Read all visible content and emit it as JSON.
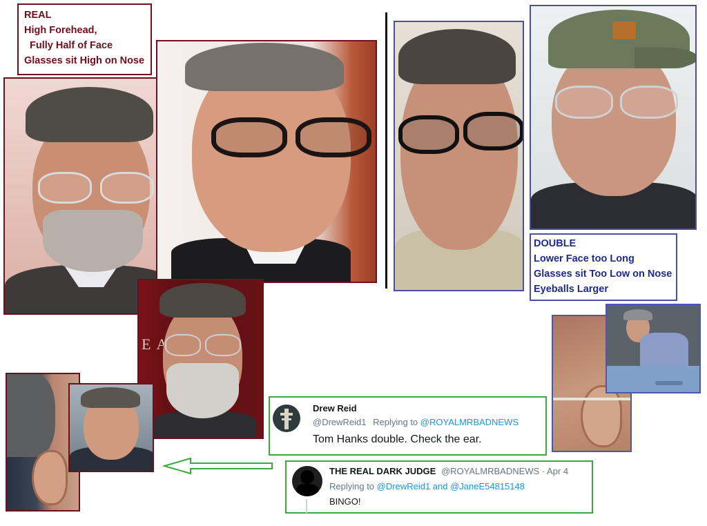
{
  "real_label": {
    "lines": [
      "REAL",
      "High Forehead,",
      "Fully Half of Face",
      "Glasses sit High on Nose"
    ]
  },
  "double_label": {
    "lines": [
      "DOUBLE",
      "Lower Face too Long",
      "Glasses sit Too Low on Nose",
      "Eyeballs Larger"
    ]
  },
  "photo_text": {
    "backdrop_letters": "EA F ye"
  },
  "tweet1": {
    "name": "Drew Reid",
    "handle": "@DrewReid1",
    "replying_prefix": "Replying to",
    "replying_to": "@ROYALMRBADNEWS",
    "text": "Tom Hanks double.  Check the ear."
  },
  "tweet2": {
    "name": "THE REAL DARK JUDGE",
    "handle_date": "@ROYALMRBADNEWS · Apr 4",
    "replying_prefix": "Replying to",
    "replying_to": "@DrewReid1 and @JaneE54815148",
    "text": "BINGO!"
  },
  "colors": {
    "real_frame": "#6e0f1d",
    "double_frame": "#4a4fa3",
    "tweet_frame": "#3aa83a",
    "link": "#1b95e0"
  }
}
